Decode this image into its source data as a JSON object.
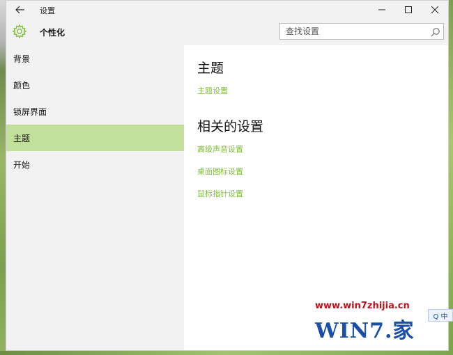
{
  "window": {
    "title": "设置",
    "controls": {
      "minimize_icon": "minimize-icon",
      "maximize_icon": "maximize-icon",
      "close_icon": "close-icon"
    }
  },
  "header": {
    "icon": "gear-icon",
    "title": "个性化",
    "search": {
      "placeholder": "查找设置",
      "value": ""
    }
  },
  "sidebar": {
    "items": [
      {
        "label": "背景",
        "selected": false
      },
      {
        "label": "颜色",
        "selected": false
      },
      {
        "label": "锁屏界面",
        "selected": false
      },
      {
        "label": "主题",
        "selected": true
      },
      {
        "label": "开始",
        "selected": false
      }
    ]
  },
  "main": {
    "section1": {
      "title": "主题",
      "links": [
        "主题设置"
      ]
    },
    "section2": {
      "title": "相关的设置",
      "links": [
        "高级声音设置",
        "桌面图标设置",
        "鼠标指针设置"
      ]
    }
  },
  "overlay": {
    "watermark_url": "www.win7zhijia.cn",
    "watermark_logo": "WIN7.家",
    "ime_text": "Q 中"
  },
  "colors": {
    "accent": "#7fbe3a",
    "selected_bg": "#c3e09b",
    "window_bg": "#f2f2f2",
    "content_bg": "#ffffff"
  }
}
